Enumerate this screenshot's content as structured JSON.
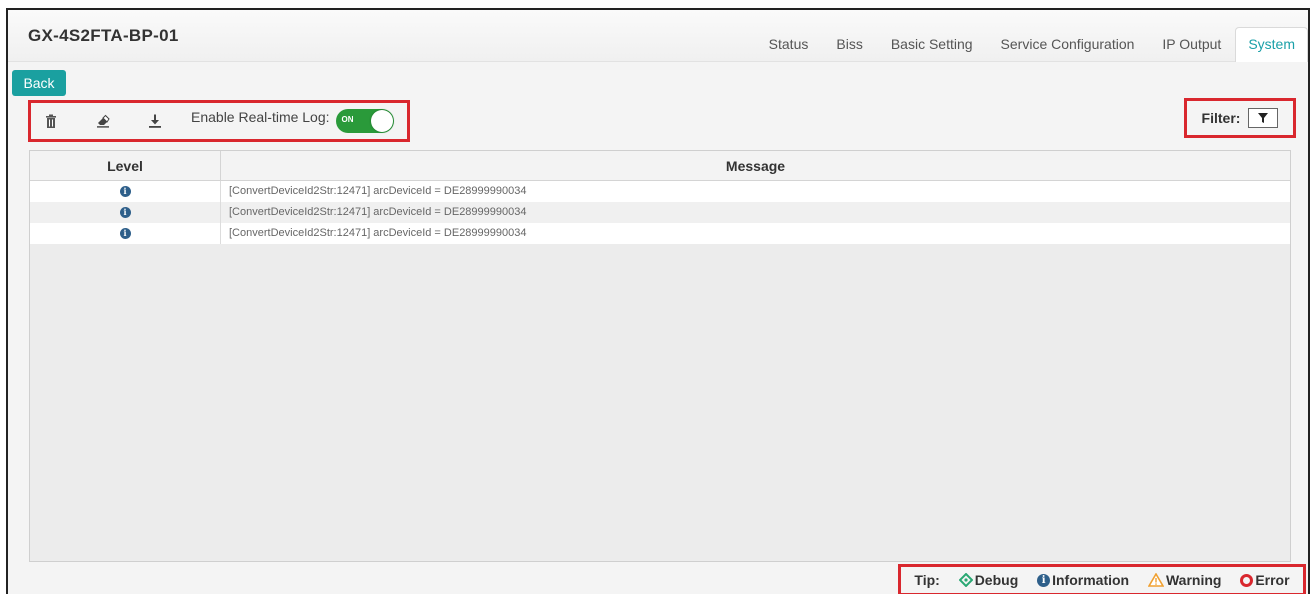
{
  "header": {
    "device_name": "GX-4S2FTA-BP-01",
    "tabs": [
      {
        "label": "Status",
        "active": false
      },
      {
        "label": "Biss",
        "active": false
      },
      {
        "label": "Basic Setting",
        "active": false
      },
      {
        "label": "Service Configuration",
        "active": false
      },
      {
        "label": "IP Output",
        "active": false
      },
      {
        "label": "System",
        "active": true
      }
    ]
  },
  "back_label": "Back",
  "toolbar": {
    "icons": [
      "trash-icon",
      "eraser-icon",
      "download-icon"
    ],
    "realtime_log_label": "Enable Real-time Log:",
    "toggle_text": "ON",
    "toggle_state": true
  },
  "filter": {
    "label": "Filter:",
    "icon": "funnel-icon"
  },
  "table": {
    "columns": [
      "Level",
      "Message"
    ],
    "rows": [
      {
        "level": "information",
        "message": "[ConvertDeviceId2Str:12471] arcDeviceId = DE28999990034"
      },
      {
        "level": "information",
        "message": "[ConvertDeviceId2Str:12471] arcDeviceId = DE28999990034"
      },
      {
        "level": "information",
        "message": "[ConvertDeviceId2Str:12471] arcDeviceId = DE28999990034"
      }
    ]
  },
  "legend": {
    "tip_label": "Tip:",
    "debug": "Debug",
    "information": "Information",
    "warning": "Warning",
    "error": "Error"
  },
  "colors": {
    "accent": "#1aa0a0",
    "highlight_border": "#d9272e",
    "toggle_on": "#2a9a3a",
    "info": "#2e5f8a",
    "debug": "#2aa873",
    "warning": "#f0a030",
    "error": "#d9272e"
  }
}
